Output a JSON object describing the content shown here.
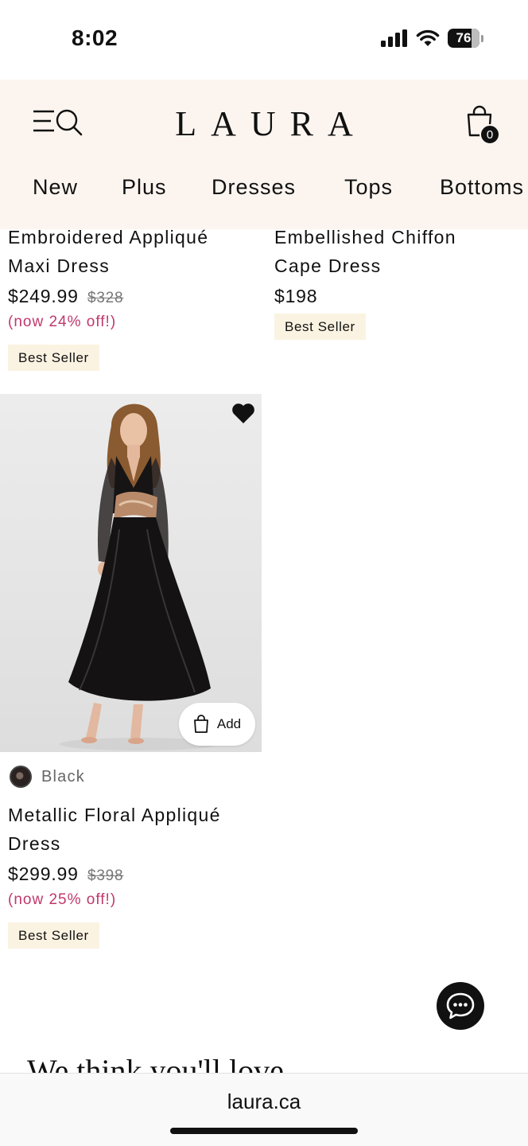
{
  "status_bar": {
    "time": "8:02",
    "battery": "76",
    "battery_level_percent": 76
  },
  "header": {
    "logo": "LAURA",
    "cart_count": "0",
    "nav": [
      {
        "label": "New"
      },
      {
        "label": "Plus"
      },
      {
        "label": "Dresses"
      },
      {
        "label": "Tops"
      },
      {
        "label": "Bottoms"
      }
    ]
  },
  "products": [
    {
      "name_line1": "Embroidered Appliqué",
      "name_line2": "Maxi Dress",
      "price": "$249.99",
      "original_price": "$328",
      "discount": "(now 24% off!)",
      "badge": "Best Seller"
    },
    {
      "name_line1": "Embellished Chiffon",
      "name_line2": "Cape Dress",
      "price": "$198",
      "badge": "Best Seller"
    },
    {
      "color": "Black",
      "add_label": "Add",
      "wishlisted": true,
      "name_line1": "Metallic Floral Appliqué",
      "name_line2": "Dress",
      "price": "$299.99",
      "original_price": "$398",
      "discount": "(now 25% off!)",
      "badge": "Best Seller"
    }
  ],
  "section_heading": "We think you'll love",
  "browser": {
    "url": "laura.ca"
  },
  "colors": {
    "header_bg": "#fcf5ef",
    "discount": "#c0386d",
    "badge_bg": "#fbf3e2"
  }
}
